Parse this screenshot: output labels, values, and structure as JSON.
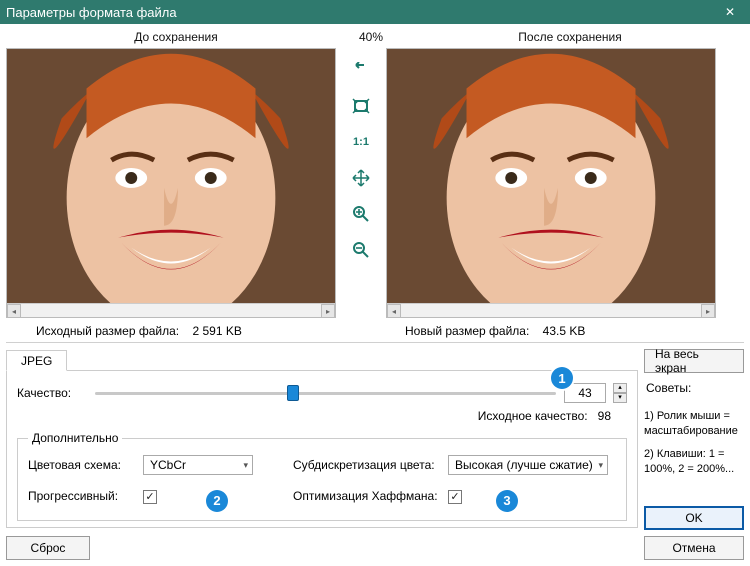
{
  "window": {
    "title": "Параметры формата файла"
  },
  "preview": {
    "before_label": "До сохранения",
    "after_label": "После сохранения",
    "zoom_percent": "40%"
  },
  "stats": {
    "original_label": "Исходный размер файла:",
    "original_value": "2 591 KB",
    "new_label": "Новый размер файла:",
    "new_value": "43.5 KB"
  },
  "tabs": {
    "jpeg": "JPEG"
  },
  "quality": {
    "label": "Качество:",
    "value": "43",
    "slider_pct": 43,
    "source_label": "Исходное качество:",
    "source_value": "98"
  },
  "advanced": {
    "legend": "Дополнительно",
    "color_scheme_label": "Цветовая схема:",
    "color_scheme_value": "YCbCr",
    "subsampling_label": "Субдискретизация цвета:",
    "subsampling_value": "Высокая (лучше сжатие)",
    "progressive_label": "Прогрессивный:",
    "progressive_checked": true,
    "huffman_label": "Оптимизация Хаффмана:",
    "huffman_checked": true
  },
  "buttons": {
    "fullscreen": "На весь экран",
    "reset": "Сброс",
    "ok": "OK",
    "cancel": "Отмена"
  },
  "hints": {
    "title": "Советы:",
    "line1": "1) Ролик мыши = масштабирование",
    "line2": "2) Клавиши: 1 = 100%, 2 = 200%..."
  },
  "callouts": {
    "c1": "1",
    "c2": "2",
    "c3": "3"
  },
  "icons": {
    "arrow_left": "◂",
    "arrow_right": "▸",
    "arrow_up": "▴",
    "arrow_down": "▾",
    "check": "✓",
    "close": "✕"
  }
}
